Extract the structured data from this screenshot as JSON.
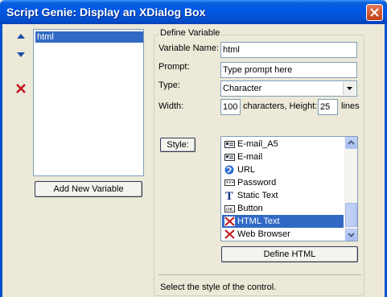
{
  "window": {
    "title": "Script Genie:  Display an XDialog Box"
  },
  "variables": {
    "items": [
      "html"
    ],
    "add_button": "Add New Variable"
  },
  "define": {
    "legend": "Define Variable",
    "name_label": "Variable Name:",
    "name_value": "html",
    "prompt_label": "Prompt:",
    "prompt_value": "Type prompt here",
    "type_label": "Type:",
    "type_value": "Character",
    "width_label": "Width:",
    "width_value": "100",
    "height_label": "characters, Height:",
    "height_value": "25",
    "lines_label": "lines",
    "style_button": "Style:",
    "styles": [
      {
        "label": "E-mail_A5",
        "icon": "email-icon"
      },
      {
        "label": "E-mail",
        "icon": "email-icon"
      },
      {
        "label": "URL",
        "icon": "globe-icon"
      },
      {
        "label": "Password",
        "icon": "password-icon"
      },
      {
        "label": "Static Text",
        "icon": "text-t-icon"
      },
      {
        "label": "Button",
        "icon": "button-icon"
      },
      {
        "label": "HTML Text",
        "icon": "html-x-icon"
      },
      {
        "label": "Web Browser",
        "icon": "browser-x-icon"
      }
    ],
    "selected_style": "HTML Text",
    "define_html_button": "Define HTML"
  },
  "status": {
    "text": "Select the style of the control."
  }
}
